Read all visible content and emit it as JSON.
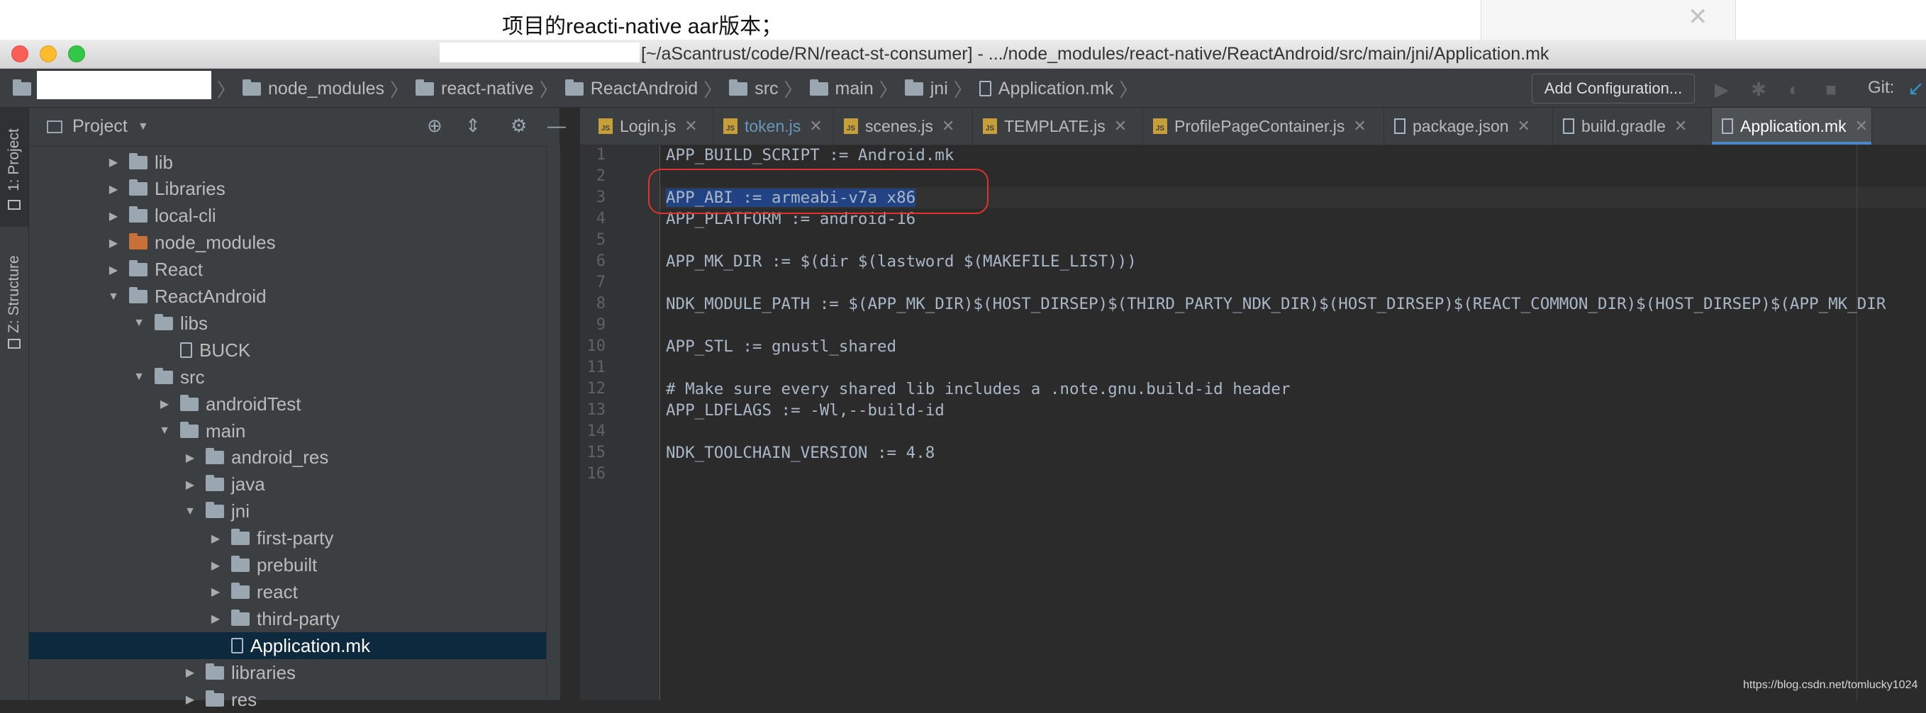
{
  "blog": {
    "note": "项目的reacti-native aar版本；",
    "close_glyph": "✕",
    "watermark": "https://blog.csdn.net/tomlucky1024"
  },
  "window": {
    "title": "[~/aScantrust/code/RN/react-st-consumer] - .../node_modules/react-native/ReactAndroid/src/main/jni/Application.mk"
  },
  "navbar": {
    "breadcrumbs": [
      "node_modules",
      "react-native",
      "ReactAndroid",
      "src",
      "main",
      "jni",
      "Application.mk"
    ],
    "add_configuration": "Add Configuration...",
    "git_label": "Git:"
  },
  "toolstrip": {
    "project_label": "1: Project",
    "structure_label": "Z: Structure"
  },
  "project_panel": {
    "title": "Project",
    "tree": [
      {
        "label": "lib",
        "type": "folder",
        "depth": 0,
        "arrow": "right"
      },
      {
        "label": "Libraries",
        "type": "folder",
        "depth": 0,
        "arrow": "right"
      },
      {
        "label": "local-cli",
        "type": "folder",
        "depth": 0,
        "arrow": "right"
      },
      {
        "label": "node_modules",
        "type": "folder-orange",
        "depth": 0,
        "arrow": "right"
      },
      {
        "label": "React",
        "type": "folder",
        "depth": 0,
        "arrow": "right"
      },
      {
        "label": "ReactAndroid",
        "type": "folder",
        "depth": 0,
        "arrow": "down"
      },
      {
        "label": "libs",
        "type": "folder",
        "depth": 1,
        "arrow": "down"
      },
      {
        "label": "BUCK",
        "type": "file",
        "depth": 2,
        "arrow": ""
      },
      {
        "label": "src",
        "type": "folder",
        "depth": 1,
        "arrow": "down"
      },
      {
        "label": "androidTest",
        "type": "folder",
        "depth": 2,
        "arrow": "right"
      },
      {
        "label": "main",
        "type": "folder",
        "depth": 2,
        "arrow": "down"
      },
      {
        "label": "android_res",
        "type": "folder",
        "depth": 3,
        "arrow": "right"
      },
      {
        "label": "java",
        "type": "folder",
        "depth": 3,
        "arrow": "right"
      },
      {
        "label": "jni",
        "type": "folder",
        "depth": 3,
        "arrow": "down"
      },
      {
        "label": "first-party",
        "type": "folder",
        "depth": 4,
        "arrow": "right"
      },
      {
        "label": "prebuilt",
        "type": "folder",
        "depth": 4,
        "arrow": "right"
      },
      {
        "label": "react",
        "type": "folder",
        "depth": 4,
        "arrow": "right"
      },
      {
        "label": "third-party",
        "type": "folder",
        "depth": 4,
        "arrow": "right"
      },
      {
        "label": "Application.mk",
        "type": "file",
        "depth": 4,
        "arrow": "",
        "selected": true
      },
      {
        "label": "libraries",
        "type": "folder",
        "depth": 3,
        "arrow": "right"
      },
      {
        "label": "res",
        "type": "folder",
        "depth": 3,
        "arrow": "right"
      }
    ]
  },
  "editor": {
    "tabs": [
      {
        "label": "Login.js",
        "icon": "js"
      },
      {
        "label": "token.js",
        "icon": "js",
        "modified": true
      },
      {
        "label": "scenes.js",
        "icon": "js"
      },
      {
        "label": "TEMPLATE.js",
        "icon": "js"
      },
      {
        "label": "ProfilePageContainer.js",
        "icon": "js"
      },
      {
        "label": "package.json",
        "icon": "json"
      },
      {
        "label": "build.gradle",
        "icon": "doc"
      },
      {
        "label": "Application.mk",
        "icon": "doc",
        "active": true
      }
    ],
    "lines": [
      "APP_BUILD_SCRIPT := Android.mk",
      "",
      "APP_ABI := armeabi-v7a x86",
      "APP_PLATFORM := android-16",
      "",
      "APP_MK_DIR := $(dir $(lastword $(MAKEFILE_LIST)))",
      "",
      "NDK_MODULE_PATH := $(APP_MK_DIR)$(HOST_DIRSEP)$(THIRD_PARTY_NDK_DIR)$(HOST_DIRSEP)$(REACT_COMMON_DIR)$(HOST_DIRSEP)$(APP_MK_DIR",
      "",
      "APP_STL := gnustl_shared",
      "",
      "# Make sure every shared lib includes a .note.gnu.build-id header",
      "APP_LDFLAGS := -Wl,--build-id",
      "",
      "NDK_TOOLCHAIN_VERSION := 4.8",
      ""
    ],
    "selected_line": 3
  },
  "colors": {
    "accent": "#4a88c7",
    "selection": "#214283",
    "annotation": "#e0322e",
    "tree_selected": "#0d293e"
  }
}
